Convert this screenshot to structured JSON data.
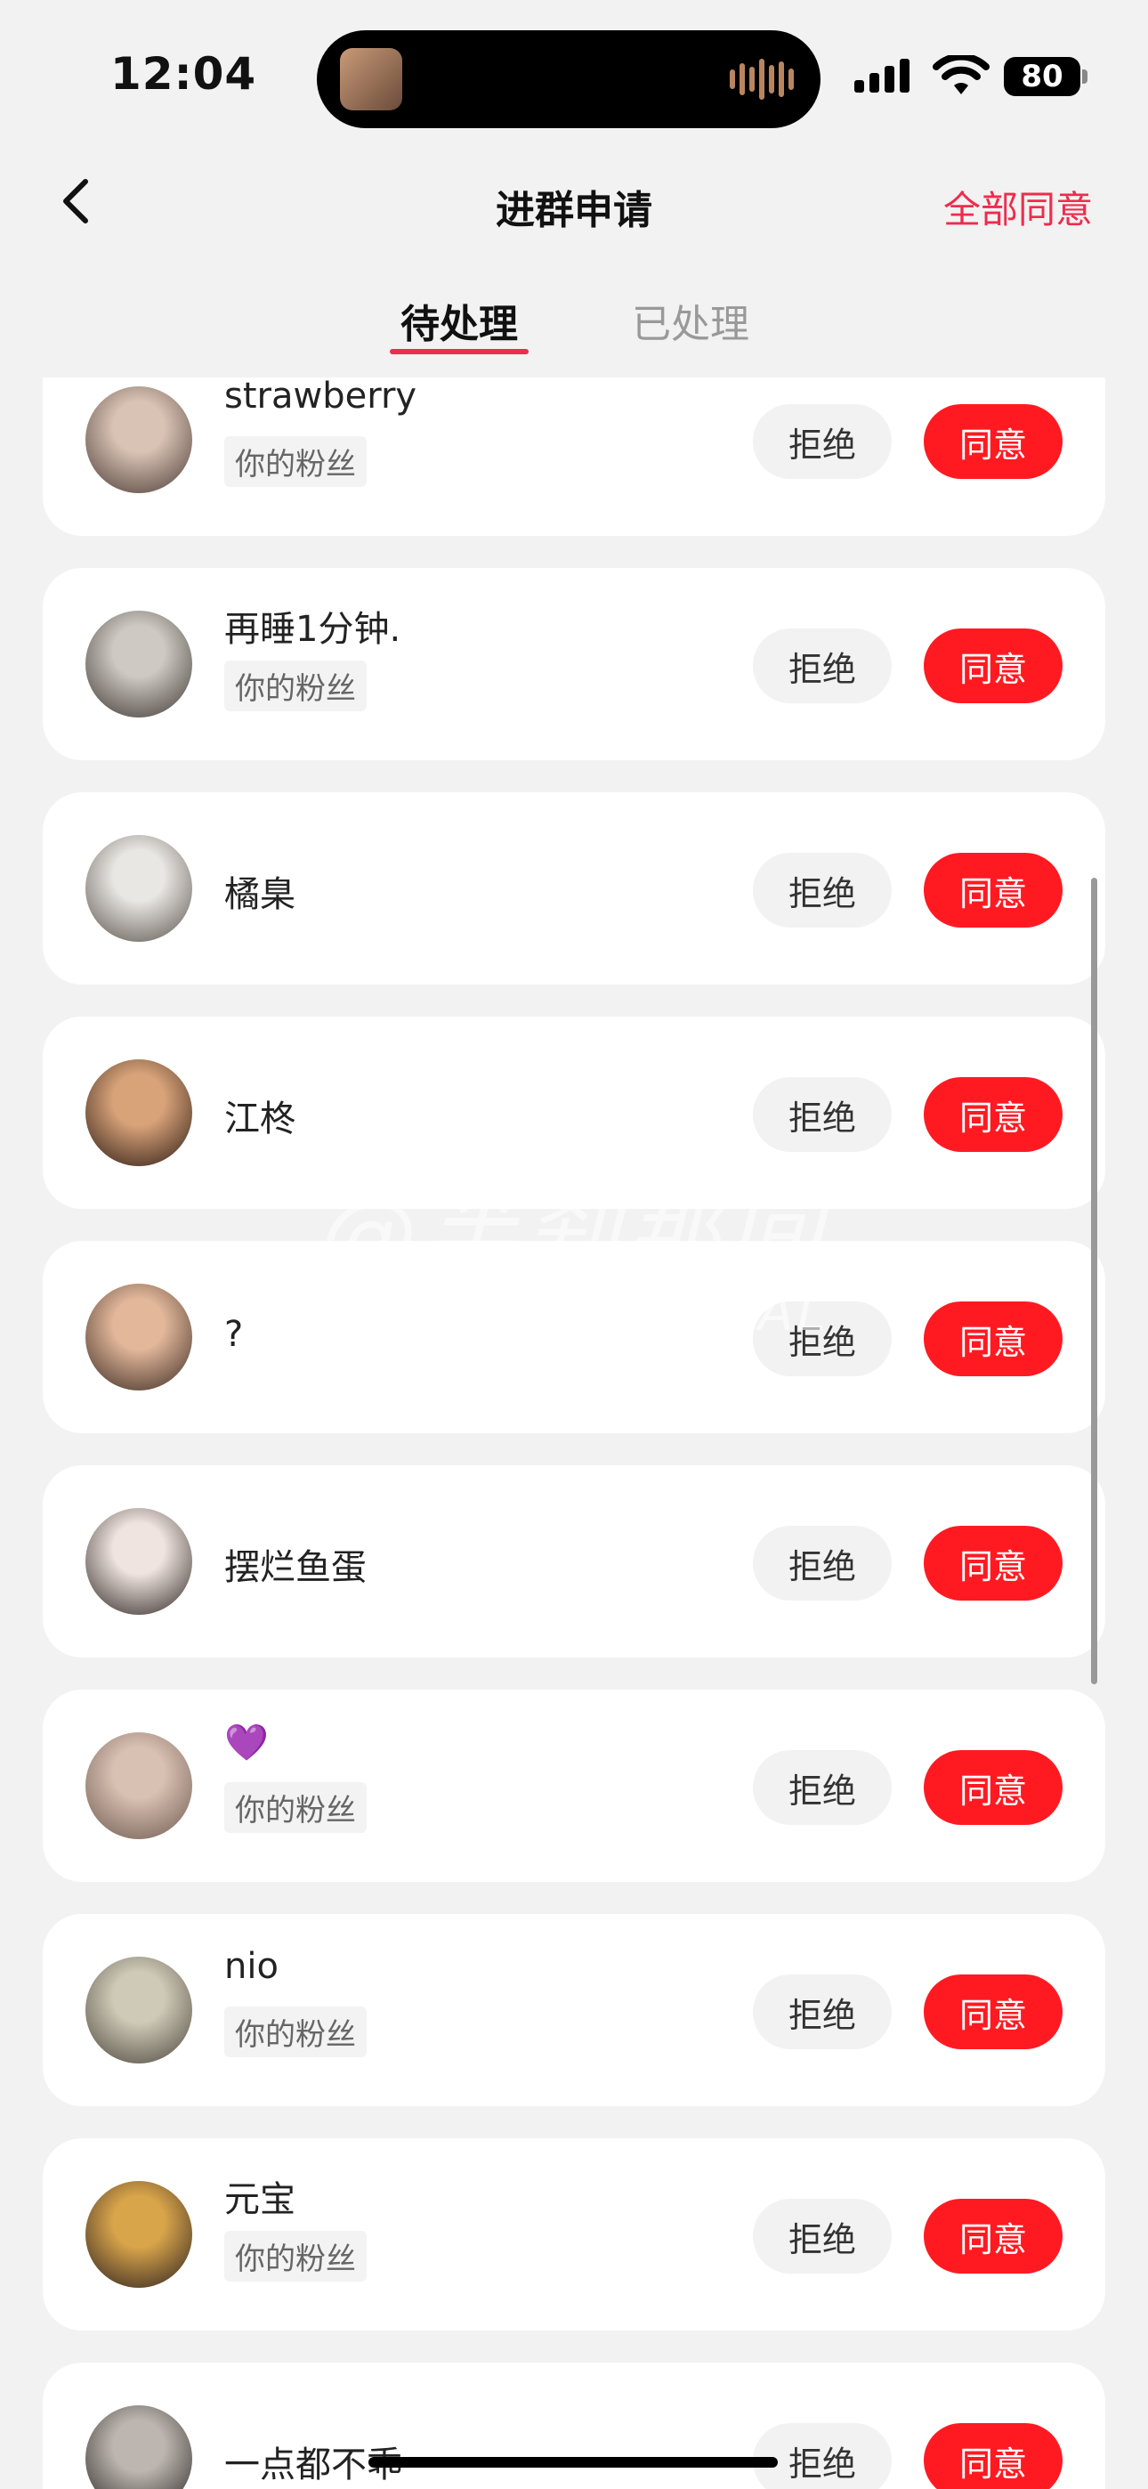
{
  "status_bar": {
    "time": "12:04",
    "battery": "80"
  },
  "header": {
    "title": "进群申请",
    "agree_all": "全部同意"
  },
  "tabs": {
    "pending": "待处理",
    "processed": "已处理"
  },
  "buttons": {
    "reject": "拒绝",
    "accept": "同意"
  },
  "requests": [
    {
      "name": "strawberry",
      "tag": "你的粉丝",
      "avatar_colors": [
        "#d9c3b5",
        "#4a3a33"
      ]
    },
    {
      "name": "再睡1分钟.",
      "tag": "你的粉丝",
      "avatar_colors": [
        "#cfc9c3",
        "#3d3632"
      ]
    },
    {
      "name": "橘臬",
      "tag": "",
      "avatar_colors": [
        "#e9e7e3",
        "#5a524c"
      ]
    },
    {
      "name": "江柊",
      "tag": "",
      "avatar_colors": [
        "#d9a37a",
        "#2a1a12"
      ]
    },
    {
      "name": "?",
      "tag": "",
      "avatar_colors": [
        "#e2b79a",
        "#3a2a22"
      ]
    },
    {
      "name": "摆烂鱼蛋",
      "tag": "",
      "avatar_colors": [
        "#efe4df",
        "#2e2624"
      ]
    },
    {
      "name": "💜",
      "tag": "你的粉丝",
      "avatar_colors": [
        "#d8c0b2",
        "#6e5a50"
      ]
    },
    {
      "name": "nio",
      "tag": "你的粉丝",
      "avatar_colors": [
        "#cfcab7",
        "#4b463b"
      ]
    },
    {
      "name": "元宝",
      "tag": "你的粉丝",
      "avatar_colors": [
        "#d9a54a",
        "#2b2020"
      ]
    },
    {
      "name": "一点都不乖",
      "tag": "",
      "avatar_colors": [
        "#bdb6b0",
        "#2a2624"
      ]
    }
  ],
  "watermark": {
    "line1": "@半刹那间",
    "line2": "VELORA CRYSTAL"
  },
  "icons": {
    "back": "chevron-left-icon",
    "wifi": "wifi-icon",
    "signal": "cellular-signal-icon"
  }
}
